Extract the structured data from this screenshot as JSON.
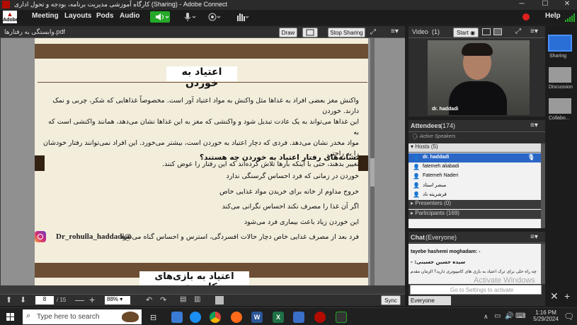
{
  "window": {
    "title": "کارگاه آموزشی مدیریت برنامه، بودجه و تحول اداری (Sharing) - Adobe Connect",
    "minimize": "─",
    "maximize": "☐",
    "close": "✕"
  },
  "menubar": {
    "logo_top": "▲",
    "logo_text": "Adobe",
    "items": [
      "Meeting",
      "Layouts",
      "Pods",
      "Audio"
    ],
    "help": "Help"
  },
  "share_pod": {
    "filename": "وابستگی به رفتارها.pdf",
    "draw_label": "Draw",
    "stop_sharing_label": "Stop Sharing"
  },
  "slide": {
    "heading1": "اعتیاد به خوردن",
    "paragraph": [
      "واکنش مغز بعضی افراد به غذاها مثل واکنش به مواد اعتیاد آور است. مخصوصاً غذاهایی که شکر، چربی و نمک دارند. خوردن",
      "این غذاها می‌تواند به یک عادت تبدیل شود و واکنشی که مغز به این غذاها نشان می‌دهد، همانند واکنشی است که به",
      "مواد مخدر نشان می‌دهد. فردی که دچار اعتیاد به خوردن است، بیشتر می‌خورد. این افراد نمی‌توانند رفتار خودشان را به راحتی",
      "تغییر بدهند، حتی با اینکه بارها تلاش کرده‌اند که این رفتار را عوض کنند."
    ],
    "subheading": "نشانه‌های رفتار اعتیاد به خوردن چه هستند؟",
    "bullets": [
      "خوردن در زمانی که فرد احساس گرسنگی ندارد",
      "خروج مداوم از خانه برای خریدن مواد غذایی خاص",
      "اگر آن غذا را مصرف نکند احساس نگرانی می‌کند",
      "این خوردن زیاد باعث بیماری فرد می‌شود",
      "فرد بعد از مصرف غذایی خاص دچار حالات افسردگی، استرس و احساس گناه می‌شود"
    ],
    "instagram_handle": "Dr_rohulla_haddadi@",
    "heading2": "اعتیاد به بازی‌های کامپیوتری"
  },
  "slide_toolbar": {
    "page_current": "8",
    "page_total": "/ 15",
    "zoom": "88%",
    "sync_label": "Sync"
  },
  "video_pod": {
    "title": "Video",
    "count": "(1)",
    "start_label": "Start",
    "presenter_name": "dr. haddadi"
  },
  "attendees_pod": {
    "title": "Attendees",
    "count": "(174)",
    "active_speakers": "Active Speakers",
    "hosts_label": "Hosts (5)",
    "hosts": [
      "dr. haddadi",
      "fatemeh aliabadi",
      "Fatemeh Naderi",
      "مبشر استاد",
      "فرشریته ناد"
    ],
    "presenters_label": "Presenters (0)",
    "participants_label": "Participants (169)"
  },
  "chat_pod": {
    "title": "Chat",
    "scope": "(Everyone)",
    "messages": [
      "tayebe hashemi moghadam: -",
      "سیده حسین حسینی: -",
      "چه راه حلی برای ترک اعتیاد به بازی های کامپیوتری دارید؟ الزمان مقدم"
    ],
    "recipient": "Everyone",
    "watermark1": "Activate Windows",
    "watermark2": "Go to Settings to activate"
  },
  "layouts_rail": {
    "items": [
      "Sharing",
      "Discussion",
      "Collabo..."
    ]
  },
  "taskbar": {
    "search_placeholder": "Type here to search",
    "time": "1:16 PM",
    "date": "5/29/2024"
  },
  "colors": {
    "adobe_red": "#b30b00",
    "mic_green": "#26a829",
    "slide_bg": "#f3eddc",
    "slide_stripe": "#6b4e33",
    "host_selected": "#2a66c6"
  }
}
